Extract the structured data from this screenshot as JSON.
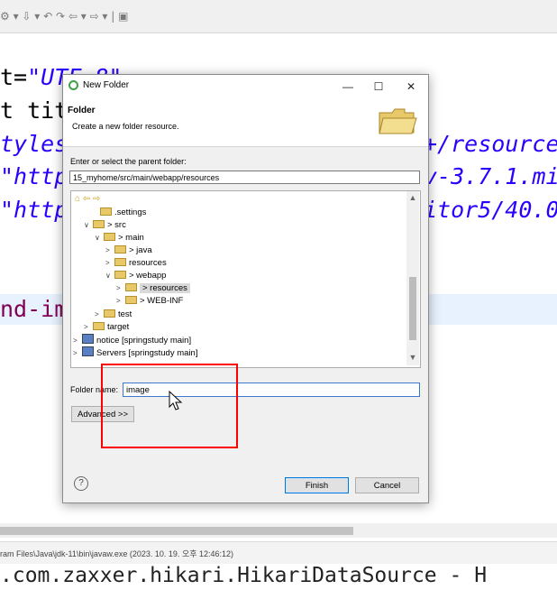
{
  "background": {
    "code_lines": [
      {
        "prefix": "t=",
        "string": "\"UTF-8\"",
        "rest": ""
      },
      {
        "prefix": "t tit",
        "string": "",
        "rest": ""
      },
      {
        "prefix": "",
        "string": "tyles",
        "rest": "",
        "tail": "+/resource"
      },
      {
        "prefix": "",
        "string": "\"http",
        "rest": "",
        "tail": "v-3.7.1.mi"
      },
      {
        "prefix": "",
        "string": "\"http",
        "rest": "",
        "tail": "itor5/40.0"
      },
      {
        "prefix": "nd-im",
        "string": "",
        "rest": ""
      }
    ],
    "console_path": "ram Files\\Java\\jdk-11\\bin\\javaw.exe  (2023. 10. 19. 오후 12:46:12)",
    "console_output": ".com.zaxxer.hikari.HikariDataSource - H"
  },
  "dialog": {
    "title": "New Folder",
    "header_title": "Folder",
    "header_desc": "Create a new folder resource.",
    "parent_label": "Enter or select the parent folder:",
    "parent_value": "15_myhome/src/main/webapp/resources",
    "tree": [
      {
        "label": ".settings",
        "twisty": "",
        "icon": "folder"
      },
      {
        "label": "> src",
        "twisty": "∨",
        "icon": "package-folder"
      },
      {
        "label": "> main",
        "twisty": "∨",
        "icon": "package-folder"
      },
      {
        "label": "> java",
        "twisty": ">",
        "icon": "folder"
      },
      {
        "label": "resources",
        "twisty": ">",
        "icon": "folder"
      },
      {
        "label": "> webapp",
        "twisty": "∨",
        "icon": "package-folder"
      },
      {
        "label": "> resources",
        "twisty": ">",
        "icon": "folder",
        "selected": true
      },
      {
        "label": "> WEB-INF",
        "twisty": ">",
        "icon": "package-folder"
      },
      {
        "label": "test",
        "twisty": ">",
        "icon": "folder"
      },
      {
        "label": "target",
        "twisty": ">",
        "icon": "folder"
      },
      {
        "label": "notice [springstudy main]",
        "twisty": ">",
        "icon": "project"
      },
      {
        "label": "Servers [springstudy main]",
        "twisty": ">",
        "icon": "project"
      }
    ],
    "folder_name_label": "Folder name:",
    "folder_name_value": "image",
    "advanced_label": "Advanced >>",
    "finish_label": "Finish",
    "cancel_label": "Cancel",
    "help_glyph": "?"
  },
  "colors": {
    "annotation_box": "#ff0000",
    "accent": "#0078d7"
  }
}
